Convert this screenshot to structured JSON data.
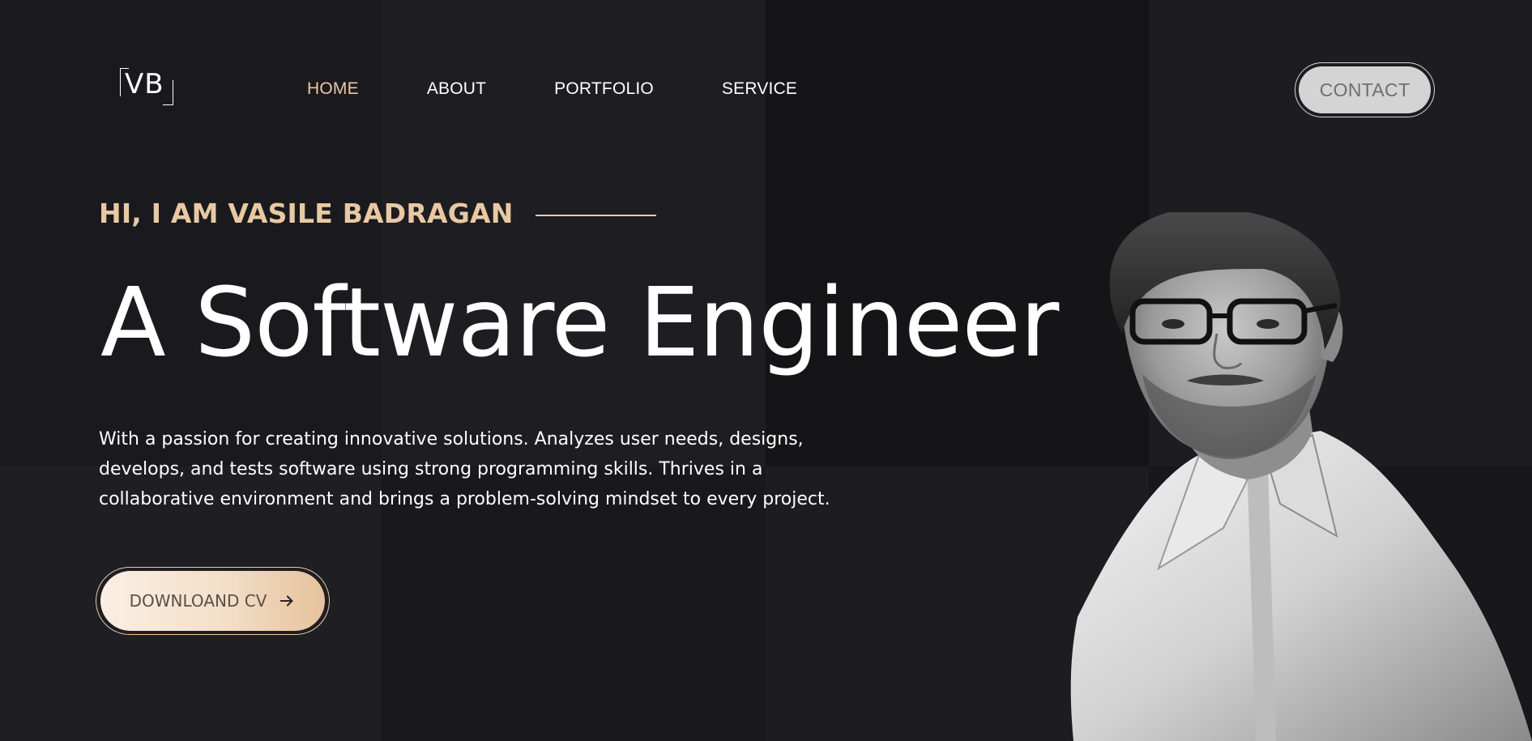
{
  "brand": {
    "logo_text": "VB"
  },
  "nav": {
    "items": [
      {
        "label": "HOME",
        "active": true
      },
      {
        "label": "ABOUT",
        "active": false
      },
      {
        "label": "PORTFOLIO",
        "active": false
      },
      {
        "label": "SERVICE",
        "active": false
      }
    ]
  },
  "header": {
    "contact_label": "CONTACT"
  },
  "hero": {
    "intro": "HI, I AM VASILE BADRAGAN",
    "headline": "A Software Engineer",
    "description": "With a passion for creating innovative solutions. Analyzes user needs, designs, develops, and tests software using strong programming skills. Thrives in a collaborative environment and brings a problem-solving mindset to every project.",
    "download_label": "DOWNLOAND CV",
    "download_icon": "arrow-right-icon",
    "portrait_icon": "person-portrait"
  },
  "colors": {
    "accent": "#e8c9a3",
    "background": "#1b1b1f",
    "text": "#ffffff"
  }
}
